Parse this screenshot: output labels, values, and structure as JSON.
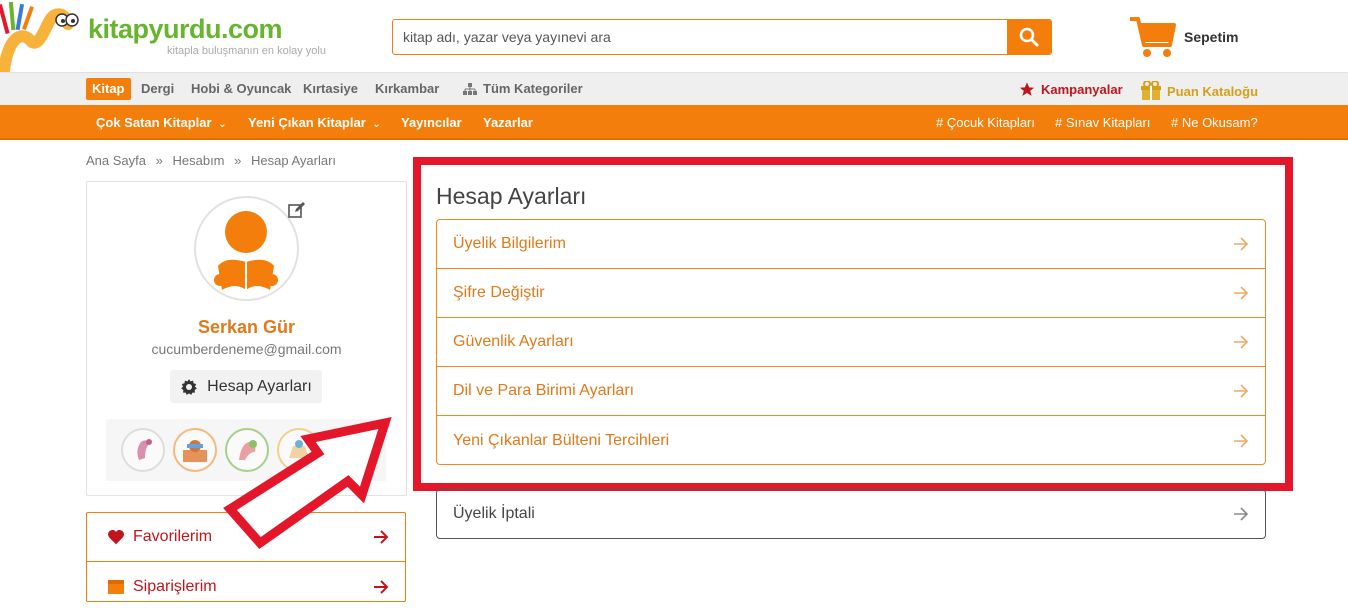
{
  "header": {
    "logo_text": "kitapyurdu.com",
    "logo_sub": "kitapla buluşmanın en kolay yolu",
    "search_placeholder": "kitap adı, yazar veya yayınevi ara",
    "cart_label": "Sepetim"
  },
  "category_bar": {
    "items": [
      "Kitap",
      "Dergi",
      "Hobi & Oyuncak",
      "Kırtasiye",
      "Kırkambar",
      "Tüm Kategoriler"
    ],
    "campaigns": "Kampanyalar",
    "points_catalog": "Puan Kataloğu"
  },
  "navbar": {
    "items": [
      "Çok Satan Kitaplar",
      "Yeni Çıkan Kitaplar",
      "Yayıncılar",
      "Yazarlar"
    ],
    "tags": [
      "# Çocuk Kitapları",
      "# Sınav Kitapları",
      "# Ne Okusam?"
    ]
  },
  "breadcrumb": {
    "items": [
      "Ana Sayfa",
      "Hesabım",
      "Hesap Ayarları"
    ],
    "separator": "»"
  },
  "profile": {
    "name": "Serkan Gür",
    "email": "cucumberdeneme@gmail.com",
    "settings_button": "Hesap Ayarları"
  },
  "sidebar": {
    "items": [
      {
        "label": "Favorilerim",
        "icon": "heart-icon"
      },
      {
        "label": "Siparişlerim",
        "icon": "box-icon"
      }
    ]
  },
  "content": {
    "title": "Hesap Ayarları",
    "settings": [
      "Üyelik Bilgilerim",
      "Şifre Değiştir",
      "Güvenlik Ayarları",
      "Dil ve Para Birimi Ayarları",
      "Yeni Çıkanlar Bülteni Tercihleri"
    ],
    "cancel_membership": "Üyelik İptali"
  },
  "colors": {
    "brand_orange": "#f47e0c",
    "logo_green": "#67b42e",
    "highlight_red": "#e3162a",
    "campaign_red": "#c0151b"
  }
}
